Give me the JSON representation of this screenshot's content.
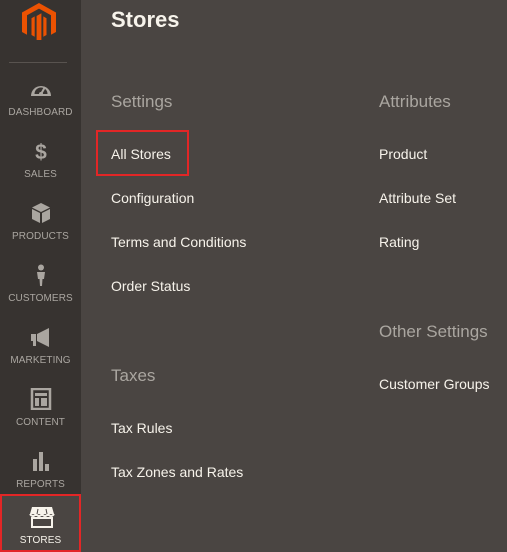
{
  "sidebar": {
    "logo": {
      "icon": "magento-logo-icon",
      "color": "#eb5202"
    },
    "items": [
      {
        "label": "DASHBOARD",
        "icon": "dashboard-gauge-icon"
      },
      {
        "label": "SALES",
        "icon": "dollar-icon"
      },
      {
        "label": "PRODUCTS",
        "icon": "cube-icon"
      },
      {
        "label": "CUSTOMERS",
        "icon": "person-icon"
      },
      {
        "label": "MARKETING",
        "icon": "megaphone-icon"
      },
      {
        "label": "CONTENT",
        "icon": "layout-icon"
      },
      {
        "label": "REPORTS",
        "icon": "bar-chart-icon"
      },
      {
        "label": "STORES",
        "icon": "storefront-icon",
        "active": true
      }
    ]
  },
  "panel": {
    "title": "Stores",
    "settings": {
      "title": "Settings",
      "links": [
        "All Stores",
        "Configuration",
        "Terms and Conditions",
        "Order Status"
      ]
    },
    "taxes": {
      "title": "Taxes",
      "links": [
        "Tax Rules",
        "Tax Zones and Rates"
      ]
    },
    "attributes": {
      "title": "Attributes",
      "links": [
        "Product",
        "Attribute Set",
        "Rating"
      ]
    },
    "other_settings": {
      "title": "Other Settings",
      "links": [
        "Customer Groups"
      ]
    }
  },
  "colors": {
    "sidebar_bg": "#373330",
    "panel_bg": "#4a4542",
    "highlight": "#e22626",
    "text": "#f7f3eb",
    "muted": "#aaa6a0"
  }
}
